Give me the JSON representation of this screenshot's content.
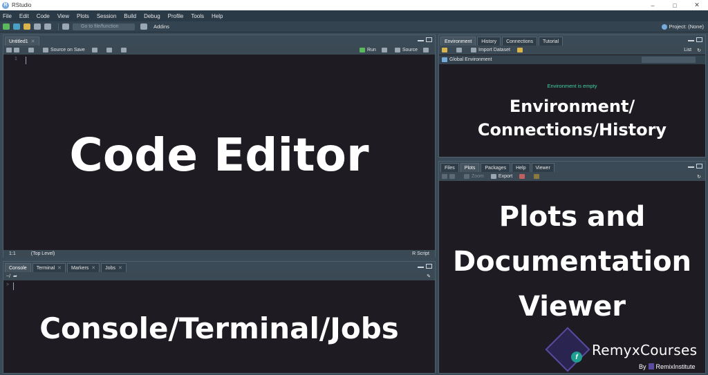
{
  "window": {
    "title": "RStudio",
    "app_icon": "R"
  },
  "menu": [
    "File",
    "Edit",
    "Code",
    "View",
    "Plots",
    "Session",
    "Build",
    "Debug",
    "Profile",
    "Tools",
    "Help"
  ],
  "toolbar": {
    "goto_placeholder": "Go to file/function",
    "addins": "Addins",
    "project": "Project: (None)"
  },
  "editor": {
    "tab": "Untitled1",
    "source_on_save": "Source on Save",
    "run": "Run",
    "source": "Source",
    "status_pos": "1:1",
    "status_scope": "(Top Level)",
    "status_type": "R Script",
    "overlay": "Code Editor"
  },
  "console": {
    "tabs": [
      "Console",
      "Terminal",
      "Markers",
      "Jobs"
    ],
    "prompt": ">",
    "path": "~/",
    "overlay": "Console/Terminal/Jobs"
  },
  "environment": {
    "tabs": [
      "Environment",
      "History",
      "Connections",
      "Tutorial"
    ],
    "import_dataset": "Import Dataset",
    "list": "List",
    "global_env": "Global Environment",
    "empty": "Environment is empty",
    "overlay_line1": "Environment/",
    "overlay_line2": "Connections/History"
  },
  "files": {
    "tabs": [
      "Files",
      "Plots",
      "Packages",
      "Help",
      "Viewer"
    ],
    "zoom": "Zoom",
    "export": "Export",
    "overlay_line1": "Plots and",
    "overlay_line2": "Documentation",
    "overlay_line3": "Viewer"
  },
  "logo": {
    "name": "RemyxCourses",
    "by": "By",
    "by_name": "RemixInstitute",
    "badge": "f"
  }
}
